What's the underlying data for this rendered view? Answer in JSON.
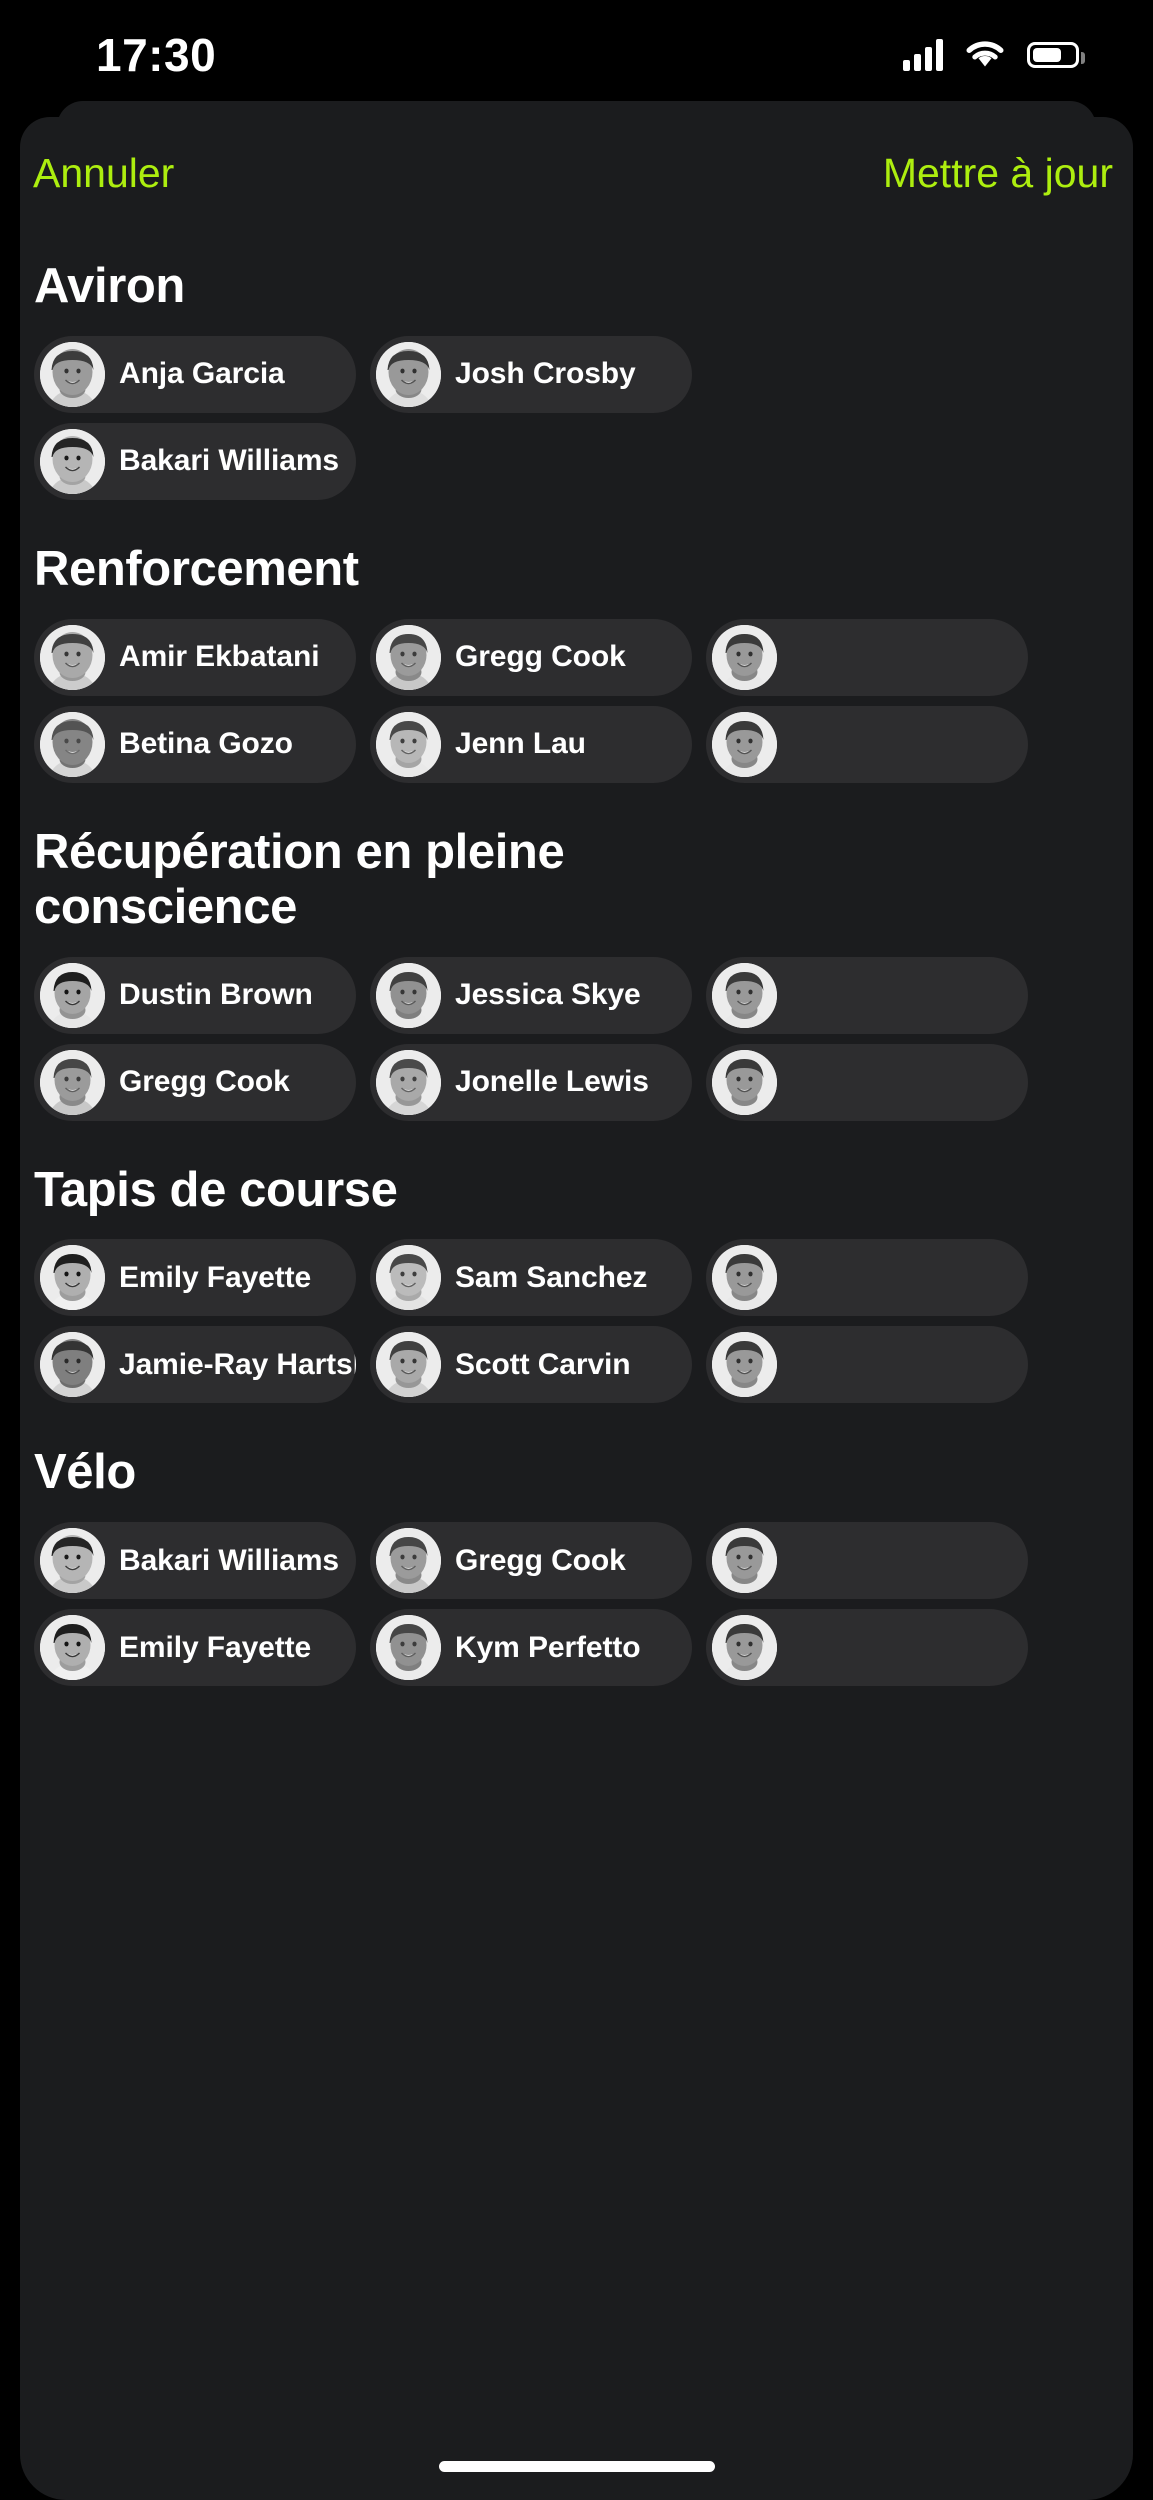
{
  "status_bar": {
    "time": "17:30",
    "cellular_icon": "cellular-bars-icon",
    "wifi_icon": "wifi-icon",
    "battery_icon": "battery-icon"
  },
  "nav": {
    "cancel_label": "Annuler",
    "update_label": "Mettre à jour",
    "accent_color": "#ADEE0F"
  },
  "theme": {
    "sheet_bg": "#1B1C1E",
    "chip_bg": "#2D2D2F",
    "text_primary": "#FFFFFF",
    "avatar_bg": "#E9E9E9"
  },
  "home_indicator": "home-indicator",
  "sections": [
    {
      "title": "Aviron",
      "rows": [
        [
          {
            "name": "Anja Garcia",
            "avatar": "avatar-anja-garcia"
          },
          {
            "name": "Josh Crosby",
            "avatar": "avatar-josh-crosby"
          }
        ],
        [
          {
            "name": "Bakari Williams",
            "avatar": "avatar-bakari-williams"
          }
        ]
      ]
    },
    {
      "title": "Renforcement",
      "rows": [
        [
          {
            "name": "Amir Ekbatani",
            "avatar": "avatar-amir-ekbatani"
          },
          {
            "name": "Gregg Cook",
            "avatar": "avatar-gregg-cook"
          },
          {
            "name": "",
            "avatar": "avatar-partial"
          }
        ],
        [
          {
            "name": "Betina Gozo",
            "avatar": "avatar-betina-gozo"
          },
          {
            "name": "Jenn Lau",
            "avatar": "avatar-jenn-lau"
          },
          {
            "name": "",
            "avatar": "avatar-partial"
          }
        ]
      ]
    },
    {
      "title": "Récupération en pleine conscience",
      "rows": [
        [
          {
            "name": "Dustin Brown",
            "avatar": "avatar-dustin-brown"
          },
          {
            "name": "Jessica Skye",
            "avatar": "avatar-jessica-skye"
          },
          {
            "name": "",
            "avatar": "avatar-partial"
          }
        ],
        [
          {
            "name": "Gregg Cook",
            "avatar": "avatar-gregg-cook"
          },
          {
            "name": "Jonelle Lewis",
            "avatar": "avatar-jonelle-lewis"
          },
          {
            "name": "",
            "avatar": "avatar-partial"
          }
        ]
      ]
    },
    {
      "title": "Tapis de course",
      "rows": [
        [
          {
            "name": "Emily Fayette",
            "avatar": "avatar-emily-fayette"
          },
          {
            "name": "Sam Sanchez",
            "avatar": "avatar-sam-sanchez"
          },
          {
            "name": "",
            "avatar": "avatar-partial"
          }
        ],
        [
          {
            "name": "Jamie-Ray Hartshorne",
            "avatar": "avatar-jamie-ray-hartshorne"
          },
          {
            "name": "Scott Carvin",
            "avatar": "avatar-scott-carvin"
          },
          {
            "name": "",
            "avatar": "avatar-partial"
          }
        ]
      ]
    },
    {
      "title": "Vélo",
      "rows": [
        [
          {
            "name": "Bakari Williams",
            "avatar": "avatar-bakari-williams"
          },
          {
            "name": "Gregg Cook",
            "avatar": "avatar-gregg-cook"
          },
          {
            "name": "",
            "avatar": "avatar-partial"
          }
        ],
        [
          {
            "name": "Emily Fayette",
            "avatar": "avatar-emily-fayette"
          },
          {
            "name": "Kym Perfetto",
            "avatar": "avatar-kym-perfetto"
          },
          {
            "name": "",
            "avatar": "avatar-partial"
          }
        ]
      ]
    }
  ]
}
